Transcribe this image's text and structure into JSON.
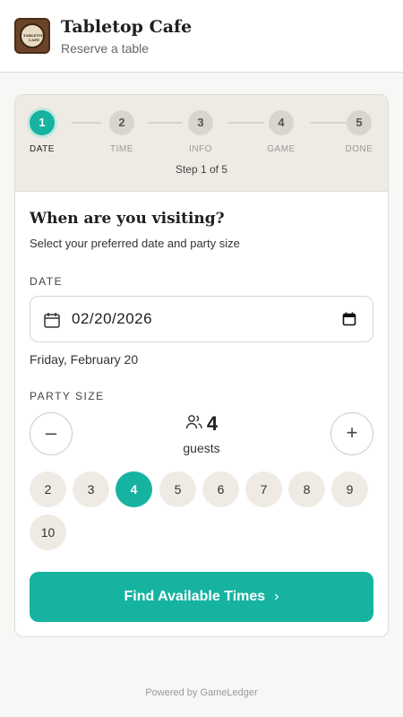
{
  "header": {
    "logo_text": "TABLETOP CAFE",
    "title": "Tabletop Cafe",
    "subtitle": "Reserve a table"
  },
  "stepper": {
    "steps": [
      {
        "num": "1",
        "label": "DATE",
        "active": true
      },
      {
        "num": "2",
        "label": "TIME",
        "active": false
      },
      {
        "num": "3",
        "label": "INFO",
        "active": false
      },
      {
        "num": "4",
        "label": "GAME",
        "active": false
      },
      {
        "num": "5",
        "label": "DONE",
        "active": false
      }
    ],
    "progress_text": "Step 1 of 5"
  },
  "form": {
    "title": "When are you visiting?",
    "subtitle": "Select your preferred date and party size",
    "date_label": "DATE",
    "date_value": "02/20/2026",
    "date_readable": "Friday, February 20",
    "party_label": "PARTY SIZE",
    "decrement": "–",
    "increment": "+",
    "guest_count": "4",
    "guest_unit": "guests",
    "size_options": [
      "2",
      "3",
      "4",
      "5",
      "6",
      "7",
      "8",
      "9",
      "10"
    ],
    "selected_size": "4",
    "cta_label": "Find Available Times",
    "cta_chevron": "›"
  },
  "footer": {
    "powered_by": "Powered by GameLedger"
  },
  "colors": {
    "accent": "#16b3a1",
    "stepper_bg": "#efebe4",
    "chip_bg": "#efebe4"
  },
  "icons": {
    "calendar": "calendar-icon",
    "people": "people-icon",
    "cal_picker": "calendar-picker-icon"
  }
}
